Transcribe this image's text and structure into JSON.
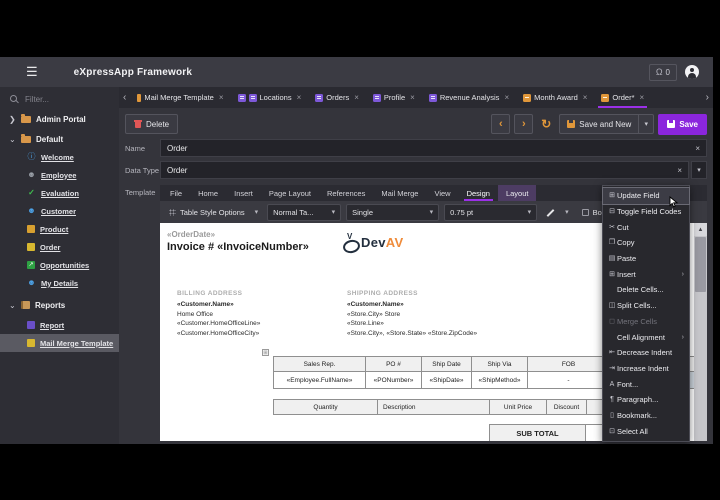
{
  "app": {
    "title": "eXpressApp Framework",
    "notification_count": "0"
  },
  "sidebar": {
    "filter_placeholder": "Filter...",
    "sections": {
      "admin_portal": "Admin Portal",
      "default": "Default",
      "reports": "Reports"
    },
    "items": [
      {
        "label": "Welcome",
        "icon": "info-icon"
      },
      {
        "label": "Employee",
        "icon": "person-icon"
      },
      {
        "label": "Evaluation",
        "icon": "check-icon"
      },
      {
        "label": "Customer",
        "icon": "person-icon"
      },
      {
        "label": "Product",
        "icon": "package-icon"
      },
      {
        "label": "Order",
        "icon": "order-icon"
      },
      {
        "label": "Opportunities",
        "icon": "chart-icon"
      },
      {
        "label": "My Details",
        "icon": "person-icon"
      }
    ],
    "report_items": [
      {
        "label": "Report",
        "icon": "report-icon"
      },
      {
        "label": "Mail Merge Template",
        "icon": "mail-merge-icon",
        "active": true
      }
    ]
  },
  "tabs": [
    {
      "label": "Mail Merge Template"
    },
    {
      "label": "Locations"
    },
    {
      "label": "Orders"
    },
    {
      "label": "Profile"
    },
    {
      "label": "Revenue Analysis"
    },
    {
      "label": "Month Award"
    },
    {
      "label": "Order*",
      "active": true
    }
  ],
  "tab_close_glyph": "×",
  "toolbar": {
    "delete_label": "Delete",
    "save_and_new_label": "Save and New",
    "save_label": "Save"
  },
  "form": {
    "name_label": "Name",
    "name_value": "Order",
    "datatype_label": "Data Type",
    "datatype_value": "Order",
    "template_label": "Template"
  },
  "ribbon": {
    "tabs": [
      "File",
      "Home",
      "Insert",
      "Page Layout",
      "References",
      "Mail Merge",
      "View",
      "Design",
      "Layout"
    ],
    "active_tab": "Design"
  },
  "editor_toolbar": {
    "table_style_options": "Table Style Options",
    "paragraph_style": "Normal Ta...",
    "line_style": "Single",
    "line_weight": "0.75 pt",
    "borders_label": "Bor"
  },
  "document": {
    "order_date": "«OrderDate»",
    "invoice_title": "Invoice # «InvoiceNumber»",
    "logo_dev": "Dev",
    "logo_av": "AV",
    "billing_header": "BILLING ADDRESS",
    "billing_lines": [
      "«Customer.Name»",
      "Home Office",
      "«Customer.HomeOfficeLine»",
      "«Customer.HomeOfficeCity»"
    ],
    "shipping_header": "SHIPPING ADDRESS",
    "shipping_lines": [
      "«Customer.Name»",
      "«Store.City» Store",
      "«Store.Line»",
      "«Store.City», «Store.State» «Store.ZipCode»"
    ],
    "info_table": {
      "headers": [
        "Sales Rep.",
        "PO #",
        "Ship Date",
        "Ship Via",
        "FOB",
        "T"
      ],
      "row": [
        "«Employee.FullName»",
        "«PONumber»",
        "«ShipDate»",
        "«ShipMethod»",
        "-",
        "«Ord"
      ]
    },
    "items_table": {
      "headers": [
        "Quantity",
        "Description",
        "Unit Price",
        "Discount"
      ],
      "subtotal": "SUB TOTAL"
    }
  },
  "context_menu": {
    "items": [
      {
        "label": "Update Field"
      },
      {
        "label": "Toggle Field Codes"
      },
      {
        "label": "Cut"
      },
      {
        "label": "Copy"
      },
      {
        "label": "Paste"
      },
      {
        "label": "Insert"
      },
      {
        "label": "Delete Cells..."
      },
      {
        "label": "Split Cells..."
      },
      {
        "label": "Merge Cells"
      },
      {
        "label": "Cell Alignment"
      },
      {
        "label": "Decrease Indent"
      },
      {
        "label": "Increase Indent"
      },
      {
        "label": "Font..."
      },
      {
        "label": "Paragraph..."
      },
      {
        "label": "Bookmark..."
      },
      {
        "label": "Select All"
      }
    ]
  },
  "colors": {
    "accent_purple": "#8b26dd",
    "accent_orange": "#e0973a",
    "danger_red": "#e05656",
    "tab_underline": "#9b30e8"
  }
}
